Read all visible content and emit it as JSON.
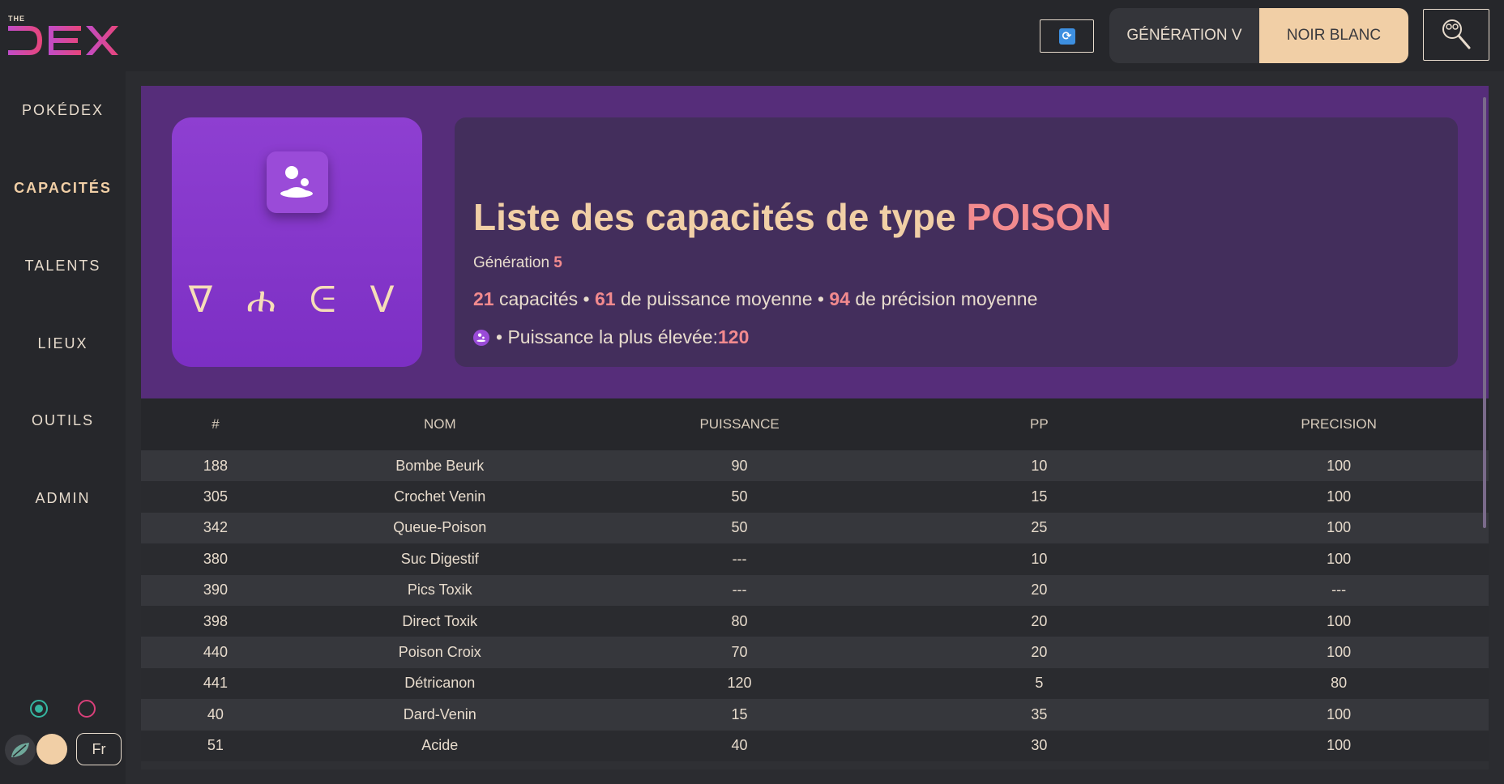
{
  "header": {
    "logo_small": "THE",
    "logo_text": "DEX",
    "generation_label": "GÉNÉRATION V",
    "version_label": "NOIR BLANC",
    "refresh_icon": "refresh-icon",
    "search_icon": "magnifier-icon"
  },
  "sidebar": {
    "items": [
      {
        "label": "POKÉDEX"
      },
      {
        "label": "CAPACITÉS"
      },
      {
        "label": "TALENTS"
      },
      {
        "label": "LIEUX"
      },
      {
        "label": "OUTILS"
      },
      {
        "label": "ADMIN"
      }
    ],
    "active_index": 1,
    "language_label": "Fr"
  },
  "hero": {
    "type_glyphs": "ᐁ ሐ ᕮ ᐯ",
    "title_prefix": "Liste des capacités de type ",
    "title_type": "POISON",
    "generation_prefix": "Génération ",
    "generation_value": "5",
    "stat_count": "21",
    "stat_count_label": " capacités • ",
    "stat_power": "61",
    "stat_power_label": " de puissance moyenne • ",
    "stat_accuracy": "94",
    "stat_accuracy_label": " de précision moyenne",
    "max_power_label": "• Puissance la plus élevée: ",
    "max_power_value": "120"
  },
  "table": {
    "headers": [
      "#",
      "NOM",
      "PUISSANCE",
      "PP",
      "PRECISION"
    ],
    "rows": [
      [
        "188",
        "Bombe Beurk",
        "90",
        "10",
        "100"
      ],
      [
        "305",
        "Crochet Venin",
        "50",
        "15",
        "100"
      ],
      [
        "342",
        "Queue-Poison",
        "50",
        "25",
        "100"
      ],
      [
        "380",
        "Suc Digestif",
        "---",
        "10",
        "100"
      ],
      [
        "390",
        "Pics Toxik",
        "---",
        "20",
        "---"
      ],
      [
        "398",
        "Direct Toxik",
        "80",
        "20",
        "100"
      ],
      [
        "440",
        "Poison Croix",
        "70",
        "20",
        "100"
      ],
      [
        "441",
        "Détricanon",
        "120",
        "5",
        "80"
      ],
      [
        "40",
        "Dard-Venin",
        "15",
        "35",
        "100"
      ],
      [
        "51",
        "Acide",
        "40",
        "30",
        "100"
      ]
    ]
  },
  "colors": {
    "accent_pink": "#f28a8e",
    "accent_cream": "#f1cfa6",
    "hero_purple": "#562d7a",
    "type_card_purple": "#8e3fd1"
  }
}
